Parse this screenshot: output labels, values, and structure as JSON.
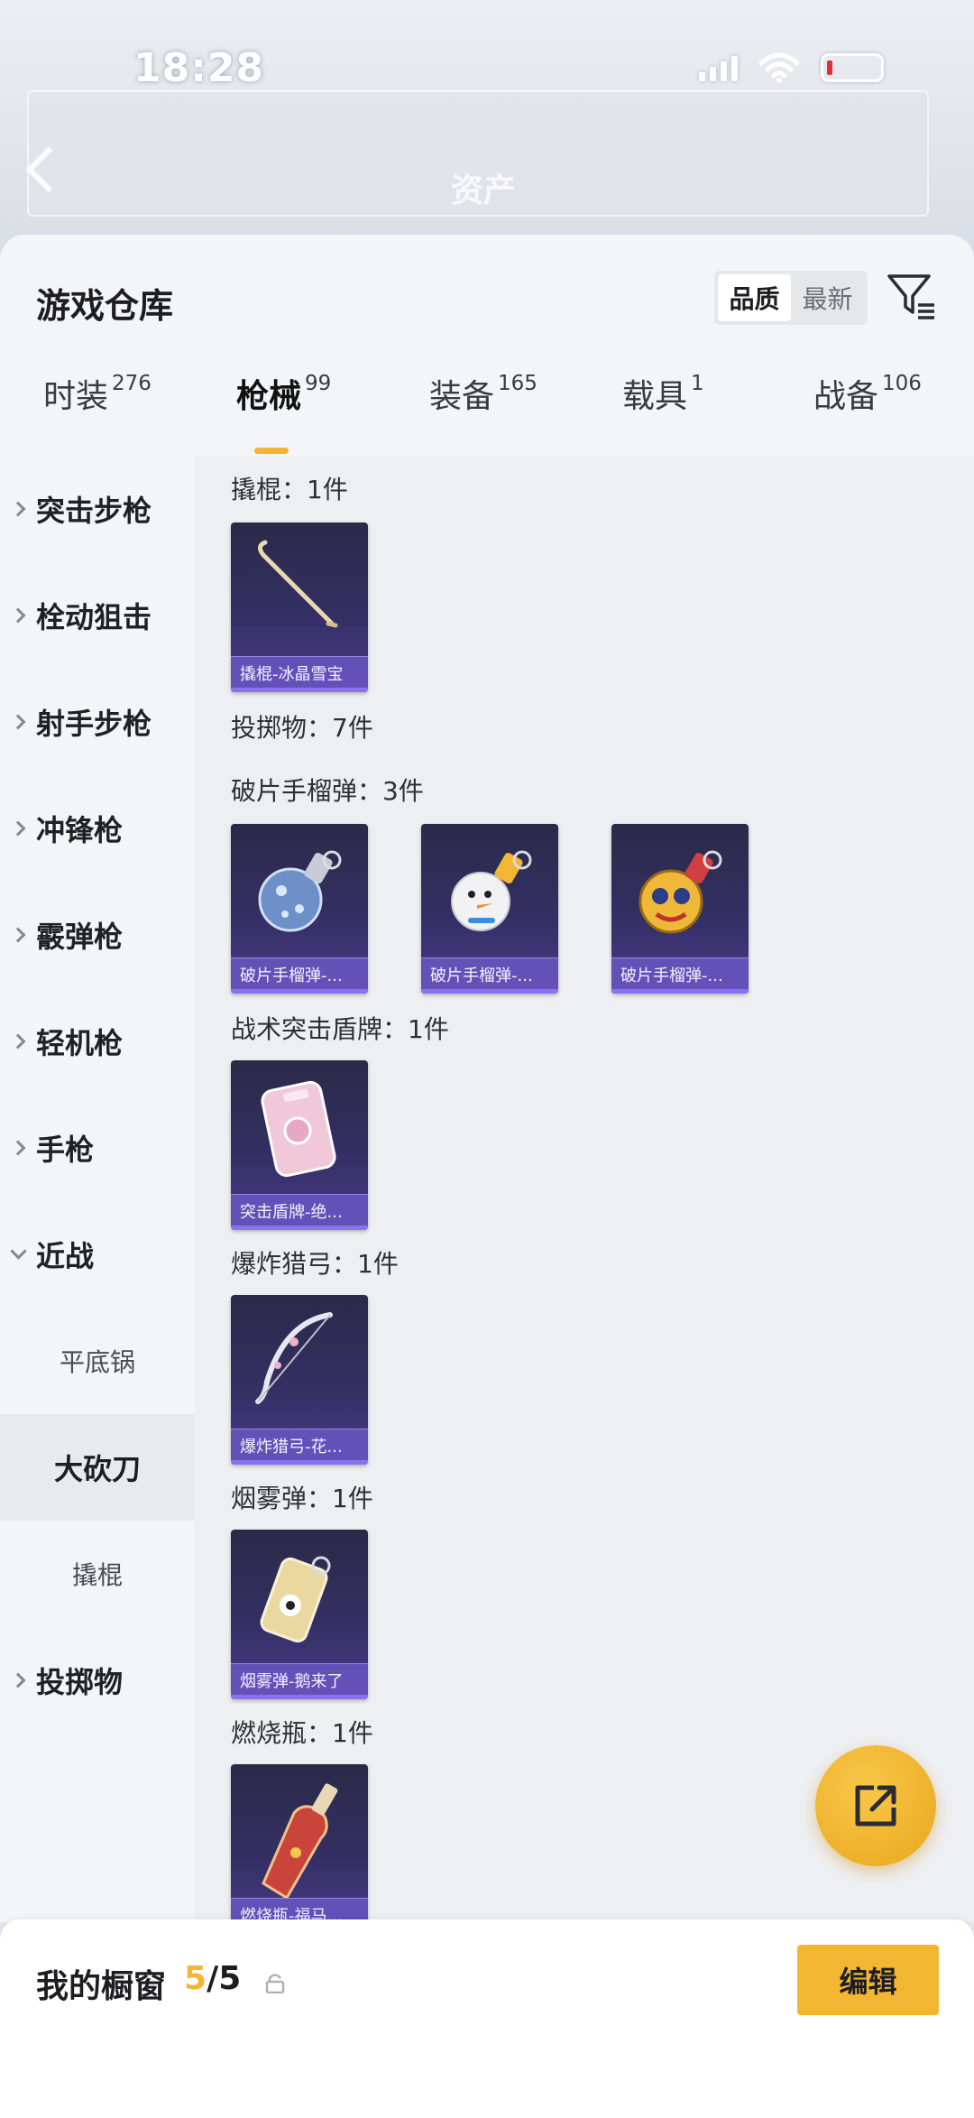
{
  "status_bar": {
    "time": "18:28"
  },
  "header": {
    "blurred_title": "资产"
  },
  "warehouse": {
    "title": "游戏仓库",
    "sort": {
      "options": [
        "品质",
        "最新"
      ],
      "selected": "品质"
    }
  },
  "tabs": [
    {
      "label": "时装",
      "count": "276"
    },
    {
      "label": "枪械",
      "count": "99",
      "active": true
    },
    {
      "label": "装备",
      "count": "165"
    },
    {
      "label": "载具",
      "count": "1"
    },
    {
      "label": "战备",
      "count": "106"
    }
  ],
  "sidebar": {
    "items": [
      {
        "label": "突击步枪"
      },
      {
        "label": "栓动狙击"
      },
      {
        "label": "射手步枪"
      },
      {
        "label": "冲锋枪"
      },
      {
        "label": "霰弹枪"
      },
      {
        "label": "轻机枪"
      },
      {
        "label": "手枪"
      },
      {
        "label": "近战",
        "expanded": true
      },
      {
        "label": "平底锅",
        "sub": true
      },
      {
        "label": "大砍刀",
        "sub": true,
        "active": true
      },
      {
        "label": "撬棍",
        "sub": true
      },
      {
        "label": "投掷物"
      }
    ]
  },
  "groups": [
    {
      "title": "撬棍：1件",
      "items": [
        {
          "name": "撬棍-冰晶雪宝",
          "icon": "crowbar-icon"
        }
      ]
    },
    {
      "title": "投掷物：7件",
      "items": []
    },
    {
      "title": "破片手榴弹：3件",
      "items": [
        {
          "name": "破片手榴弹-...",
          "icon": "blue-grenade-icon"
        },
        {
          "name": "破片手榴弹-...",
          "icon": "snowman-grenade-icon"
        },
        {
          "name": "破片手榴弹-...",
          "icon": "yellow-grenade-icon"
        }
      ]
    },
    {
      "title": "战术突击盾牌：1件",
      "items": [
        {
          "name": "突击盾牌-绝...",
          "icon": "pink-shield-icon"
        }
      ]
    },
    {
      "title": "爆炸猎弓：1件",
      "items": [
        {
          "name": "爆炸猎弓-花...",
          "icon": "bow-icon"
        }
      ]
    },
    {
      "title": "烟雾弹：1件",
      "items": [
        {
          "name": "烟雾弹-鹅来了",
          "icon": "smoke-grenade-icon"
        }
      ]
    },
    {
      "title": "燃烧瓶：1件",
      "items": [
        {
          "name": "燃烧瓶-福马...",
          "icon": "molotov-icon"
        }
      ]
    }
  ],
  "showcase": {
    "label": "我的橱窗",
    "current": "5",
    "total": "/5",
    "edit_label": "编辑"
  },
  "colors": {
    "accent": "#f2b632",
    "card_bg": "#342f63",
    "card_footer": "#6654be"
  }
}
